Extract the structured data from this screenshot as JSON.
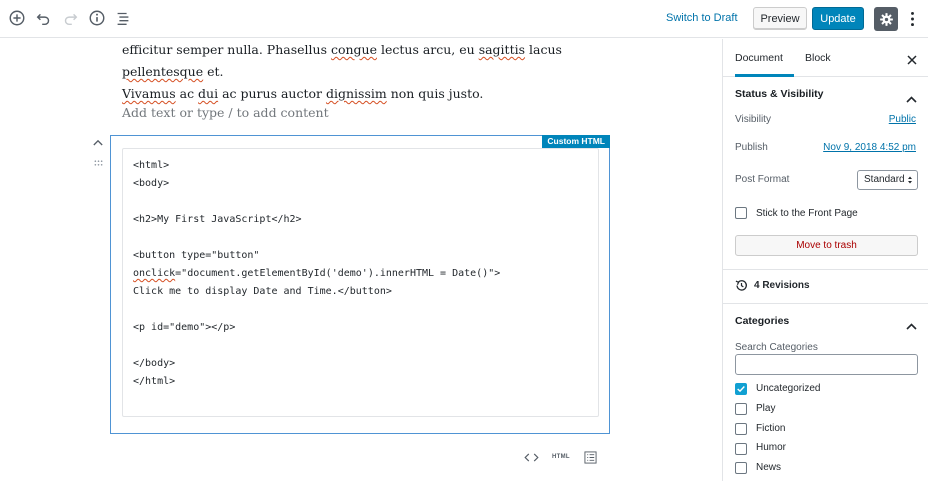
{
  "toolbar": {
    "switch_to_draft": "Switch to Draft",
    "preview": "Preview",
    "update": "Update",
    "icons": [
      "add-block-icon",
      "undo-icon",
      "redo-icon",
      "info-icon",
      "list-view-icon",
      "gear-icon",
      "more-vertical-icon"
    ]
  },
  "editor": {
    "paragraph_line1_a": "efficitur semper nulla. Phasellus ",
    "paragraph_line1_squig1": "congue",
    "paragraph_line1_b": " lectus arcu, eu ",
    "paragraph_line1_squig2": "sagittis",
    "paragraph_line1_c": " lacus ",
    "paragraph_line1_squig3": "pellentesque",
    "paragraph_line1_d": " et.",
    "paragraph_line2_squig1": "Vivamus",
    "paragraph_line2_a": " ac ",
    "paragraph_line2_squig2": "dui",
    "paragraph_line2_b": " ac purus auctor ",
    "paragraph_line2_squig3": "dignissim",
    "paragraph_line2_c": " non quis justo.",
    "placeholder": "Add text or type / to add content",
    "html_block": {
      "badge": "Custom HTML",
      "lines": [
        "<html>",
        "<body>",
        "",
        "<h2>My First JavaScript</h2>",
        "",
        "<button type=\"button\"",
        "onclick=\"document.getElementById('demo').innerHTML = Date()\">",
        "Click me to display Date and Time.</button>",
        "",
        "<p id=\"demo\"></p>",
        "",
        "</body>",
        "</html>"
      ],
      "tool_html_label": "HTML"
    }
  },
  "sidebar": {
    "tabs": [
      "Document",
      "Block"
    ],
    "status_visibility": {
      "title": "Status & Visibility",
      "visibility_label": "Visibility",
      "visibility_value": "Public",
      "publish_label": "Publish",
      "publish_value": "Nov 9, 2018 4:52 pm",
      "post_format_label": "Post Format",
      "post_format_value": "Standard",
      "stick_label": "Stick to the Front Page",
      "stick_checked": false,
      "trash": "Move to trash"
    },
    "revisions": "4 Revisions",
    "categories": {
      "title": "Categories",
      "search_label": "Search Categories",
      "items": [
        {
          "label": "Uncategorized",
          "checked": true
        },
        {
          "label": "Play",
          "checked": false
        },
        {
          "label": "Fiction",
          "checked": false
        },
        {
          "label": "Humor",
          "checked": false
        },
        {
          "label": "News",
          "checked": false
        }
      ]
    }
  },
  "colors": {
    "primary": "#0085ba",
    "link": "#0073aa",
    "danger": "#aa0000",
    "checked": "#11a0d2"
  }
}
